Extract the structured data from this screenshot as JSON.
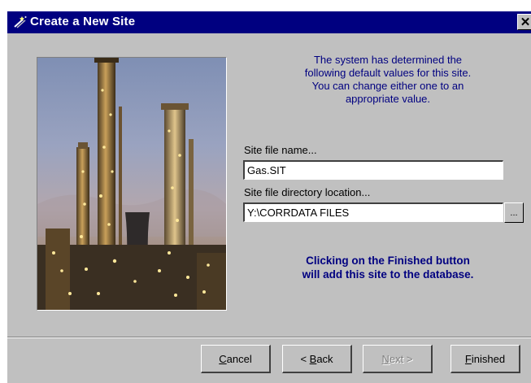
{
  "window": {
    "title": "Create a New Site",
    "close_label": "✕"
  },
  "icons": {
    "title_icon": "wizard-wand-icon",
    "close": "close-icon"
  },
  "info": {
    "line1": "The system has determined the",
    "line2": "following default values for this site.",
    "line3": "You can change either one to an",
    "line4": "appropriate value."
  },
  "form": {
    "site_file_label": "Site file name...",
    "site_file_value": "Gas.SIT",
    "dir_label": "Site file directory location...",
    "dir_value": "Y:\\CORRDATA FILES",
    "browse_label": "..."
  },
  "note": {
    "line1": "Clicking on the Finished button",
    "line2": "will add this site to the database."
  },
  "buttons": {
    "cancel_mnemonic": "C",
    "cancel_rest": "ancel",
    "back_prefix": "< ",
    "back_mnemonic": "B",
    "back_rest": "ack",
    "next_mnemonic": "N",
    "next_rest": "ext >",
    "finished_mnemonic": "F",
    "finished_rest": "inished"
  },
  "colors": {
    "titlebar": "#000080",
    "dialog": "#c0c0c0",
    "info_text": "#000080"
  }
}
